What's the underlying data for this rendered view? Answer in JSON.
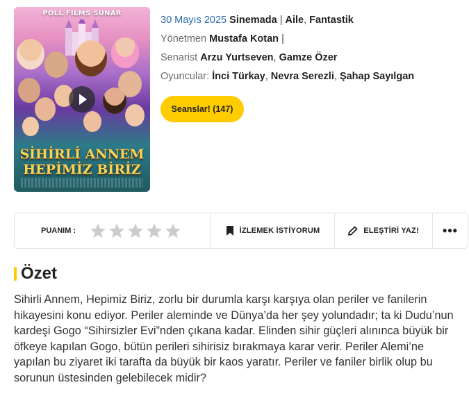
{
  "poster": {
    "brand": "POLL FILMS SUNAR",
    "logo_line1": "SİHİRLİ ANNEM",
    "logo_line2": "HEPİMİZ BİRİZ"
  },
  "movie": {
    "date": "30 Mayıs 2025",
    "release": "Sinemada",
    "genres": [
      "Aile",
      "Fantastik"
    ],
    "director_label": "Yönetmen",
    "director": "Mustafa Kotan",
    "writer_label": "Senarist",
    "writers": [
      "Arzu Yurtseven",
      "Gamze Özer"
    ],
    "cast_label": "Oyuncular:",
    "cast": [
      "İnci Türkay",
      "Nevra Serezli",
      "Şahap Sayılgan"
    ]
  },
  "sessions_button": "Seanslar! (147)",
  "actionbar": {
    "rating_label": "PUANIM :",
    "rating_value": 0,
    "rating_max": 5,
    "watchlist_label": "İZLEMEK İSTİYORUM",
    "review_label": "ELEŞTİRİ YAZ!"
  },
  "summary": {
    "heading": "Özet",
    "text": "Sihirli Annem, Hepimiz Biriz, zorlu bir durumla karşı karşıya olan periler ve fanilerin hikayesini konu ediyor. Periler aleminde ve Dünya’da her şey yolundadır; ta ki Dudu’nun kardeşi Gogo “Sihirsizler Evi”nden çıkana kadar. Elinden sihir güçleri alınınca büyük bir öfkeye kapılan Gogo, bütün perileri sihirisiz bırakmaya karar verir. Periler Alemi’ne yapılan bu ziyaret iki tarafta da büyük bir kaos yaratır. Periler ve faniler birlik olup bu sorunun üstesinden gelebilecek midir?"
  },
  "colors": {
    "accent": "#ffcc00",
    "date": "#2a6bb0",
    "star_empty": "#cccccc"
  }
}
